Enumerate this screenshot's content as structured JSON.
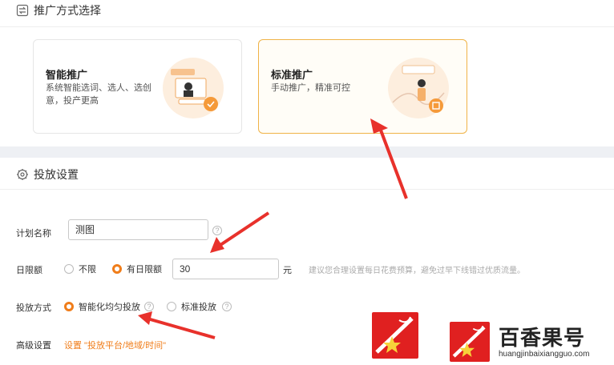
{
  "section1": {
    "title": "推广方式选择"
  },
  "cards": [
    {
      "title": "智能推广",
      "desc": "系统智能选词、选人、选创意，投产更高"
    },
    {
      "title": "标准推广",
      "desc": "手动推广，精准可控"
    }
  ],
  "section2": {
    "title": "投放设置"
  },
  "plan": {
    "label": "计划名称",
    "value": "测图"
  },
  "daily": {
    "label": "日限额",
    "opt_none": "不限",
    "opt_limit": "有日限额",
    "value": "30",
    "unit": "元",
    "tip": "建议您合理设置每日花费预算，避免过早下线错过优质流量。"
  },
  "mode": {
    "label": "投放方式",
    "opt_smart": "智能化均匀投放",
    "opt_std": "标准投放"
  },
  "advanced": {
    "label": "高级设置",
    "link": "设置 \"投放平台/地域/时间\""
  },
  "watermark": {
    "brand": "百香果号",
    "url": "huangjinbaixiangguo.com"
  },
  "colors": {
    "accent": "#f07d1a",
    "active_border": "#f0b347",
    "arrow": "#e8312b",
    "logo": "#e02020"
  }
}
